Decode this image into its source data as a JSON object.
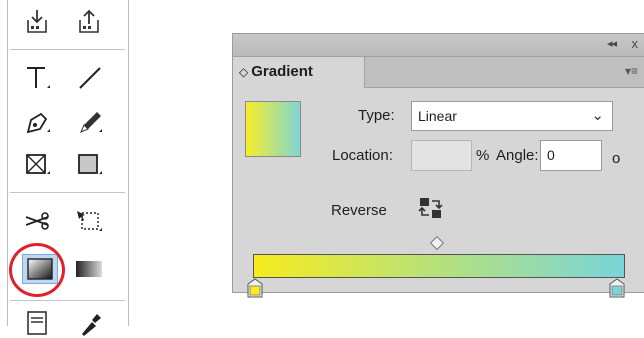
{
  "tools_panel": {
    "tools": [
      {
        "name": "place-icon"
      },
      {
        "name": "export-icon"
      },
      {
        "name": "type-tool-icon"
      },
      {
        "name": "line-tool-icon"
      },
      {
        "name": "pen-tool-icon"
      },
      {
        "name": "pencil-tool-icon"
      },
      {
        "name": "rectangle-frame-tool-icon"
      },
      {
        "name": "rectangle-tool-icon"
      },
      {
        "name": "scissors-tool-icon"
      },
      {
        "name": "free-transform-tool-icon"
      },
      {
        "name": "gradient-swatch-tool-icon",
        "selected": true
      },
      {
        "name": "gradient-feather-tool-icon"
      },
      {
        "name": "note-tool-icon"
      },
      {
        "name": "eyedropper-tool-icon"
      }
    ],
    "highlight_color": "#e2202a"
  },
  "gradient_panel": {
    "title_controls": {
      "collapse": "◂◂",
      "close": "x"
    },
    "tab_label": "Gradient",
    "type": {
      "label": "Type:",
      "value": "Linear"
    },
    "location": {
      "label": "Location:",
      "value": "",
      "unit": "%"
    },
    "angle": {
      "label": "Angle:",
      "value": "0",
      "unit": "o"
    },
    "reverse": {
      "label": "Reverse"
    },
    "colors": {
      "start": "#f6ec1f",
      "end": "#78d5d9"
    }
  }
}
